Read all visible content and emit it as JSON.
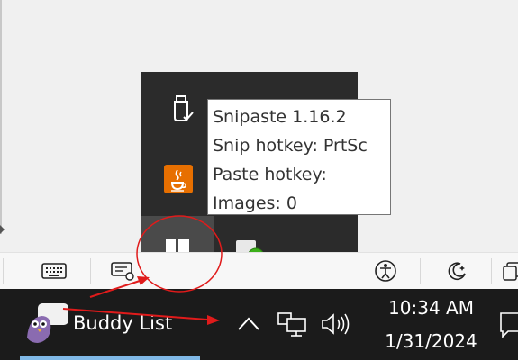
{
  "tooltip": {
    "line1": "Snipaste 1.16.2",
    "line2": "Snip hotkey: PrtSc",
    "line3": "Paste hotkey:",
    "line4": "Images: 0"
  },
  "tray_icons": [
    "usb-eject-icon",
    "java-update-icon",
    "snipaste-icon",
    "pidgin-status-icon",
    "monitor-icon"
  ],
  "toolbar_icons": [
    "keyboard-icon",
    "screen-pen-icon",
    "accessibility-icon",
    "moon-icon",
    "copy-icon"
  ],
  "taskbar": {
    "app_label": "Buddy List",
    "time": "10:34 AM",
    "date": "1/31/2024"
  },
  "colors": {
    "taskbar": "#1b1b1b",
    "popup": "#2b2b2b",
    "annotation": "#e01b1b",
    "java": "#e76f00",
    "green_status": "#3cb01a"
  }
}
